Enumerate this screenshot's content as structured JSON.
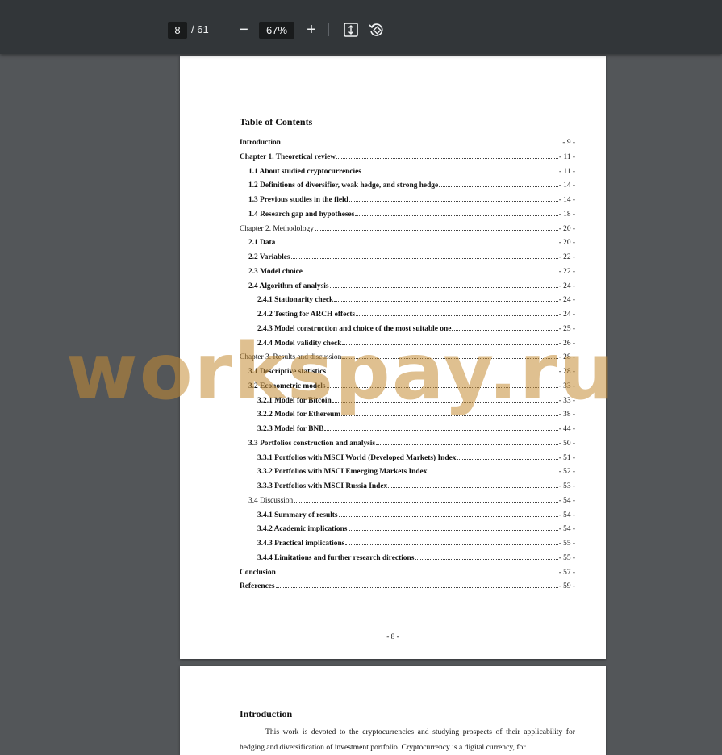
{
  "toolbar": {
    "current_page": "8",
    "total_pages": "/ 61",
    "zoom_out_symbol": "−",
    "zoom_level": "67%",
    "zoom_in_symbol": "+"
  },
  "page1": {
    "toc_title": "Table of Contents",
    "entries": [
      {
        "label": "Introduction",
        "page": "- 9 -"
      },
      {
        "label": "Chapter 1. Theoretical review",
        "page": "- 11 -"
      },
      {
        "label": "1.1 About studied cryptocurrencies",
        "page": "- 11 -"
      },
      {
        "label": "1.2 Definitions of diversifier, weak hedge, and strong hedge",
        "page": "- 14 -"
      },
      {
        "label": "1.3 Previous studies in the field",
        "page": "- 14 -"
      },
      {
        "label": "1.4 Research gap and hypotheses",
        "page": "- 18 -"
      },
      {
        "label": "Chapter 2. Methodology",
        "page": "- 20 -"
      },
      {
        "label": "2.1 Data",
        "page": "- 20 -"
      },
      {
        "label": "2.2 Variables",
        "page": "- 22 -"
      },
      {
        "label": "2.3 Model choice",
        "page": "- 22 -"
      },
      {
        "label": "2.4 Algorithm of analysis",
        "page": "- 24 -"
      },
      {
        "label": "2.4.1 Stationarity check",
        "page": "- 24 -"
      },
      {
        "label": "2.4.2 Testing for ARCH effects",
        "page": "- 24 -"
      },
      {
        "label": "2.4.3 Model construction and choice of the most suitable one",
        "page": "- 25 -"
      },
      {
        "label": "2.4.4 Model validity check",
        "page": "- 26 -"
      },
      {
        "label": "Chapter 3. Results and discussion",
        "page": "- 28 -"
      },
      {
        "label": "3.1 Descriptive statistics",
        "page": "- 28 -"
      },
      {
        "label": "3.2 Econometric models",
        "page": "- 33 -"
      },
      {
        "label": "3.2.1 Model for Bitcoin",
        "page": "- 33 -"
      },
      {
        "label": "3.2.2 Model for Ethereum",
        "page": "- 38 -"
      },
      {
        "label": "3.2.3 Model for BNB",
        "page": "- 44 -"
      },
      {
        "label": "3.3 Portfolios construction and analysis",
        "page": "- 50 -"
      },
      {
        "label": "3.3.1 Portfolios with MSCI World (Developed Markets) Index",
        "page": "- 51 -"
      },
      {
        "label": "3.3.2 Portfolios with MSCI Emerging Markets Index",
        "page": "- 52 -"
      },
      {
        "label": "3.3.3 Portfolios with MSCI Russia Index",
        "page": "- 53 -"
      },
      {
        "label": "3.4 Discussion",
        "page": "- 54 -"
      },
      {
        "label": "3.4.1 Summary of results",
        "page": "- 54 -"
      },
      {
        "label": "3.4.2 Academic implications",
        "page": "- 54 -"
      },
      {
        "label": "3.4.3 Practical implications",
        "page": "- 55 -"
      },
      {
        "label": "3.4.4 Limitations and further research directions",
        "page": "- 55 -"
      },
      {
        "label": "Conclusion",
        "page": "- 57 -"
      },
      {
        "label": "References",
        "page": "- 59 -"
      }
    ],
    "page_number": "- 8 -"
  },
  "page2": {
    "heading": "Introduction",
    "paragraph": "This work is devoted to the cryptocurrencies and studying prospects of their applicability for hedging and diversification of investment portfolio. Cryptocurrency is a digital currency, for"
  },
  "watermark": "workspay.ru"
}
